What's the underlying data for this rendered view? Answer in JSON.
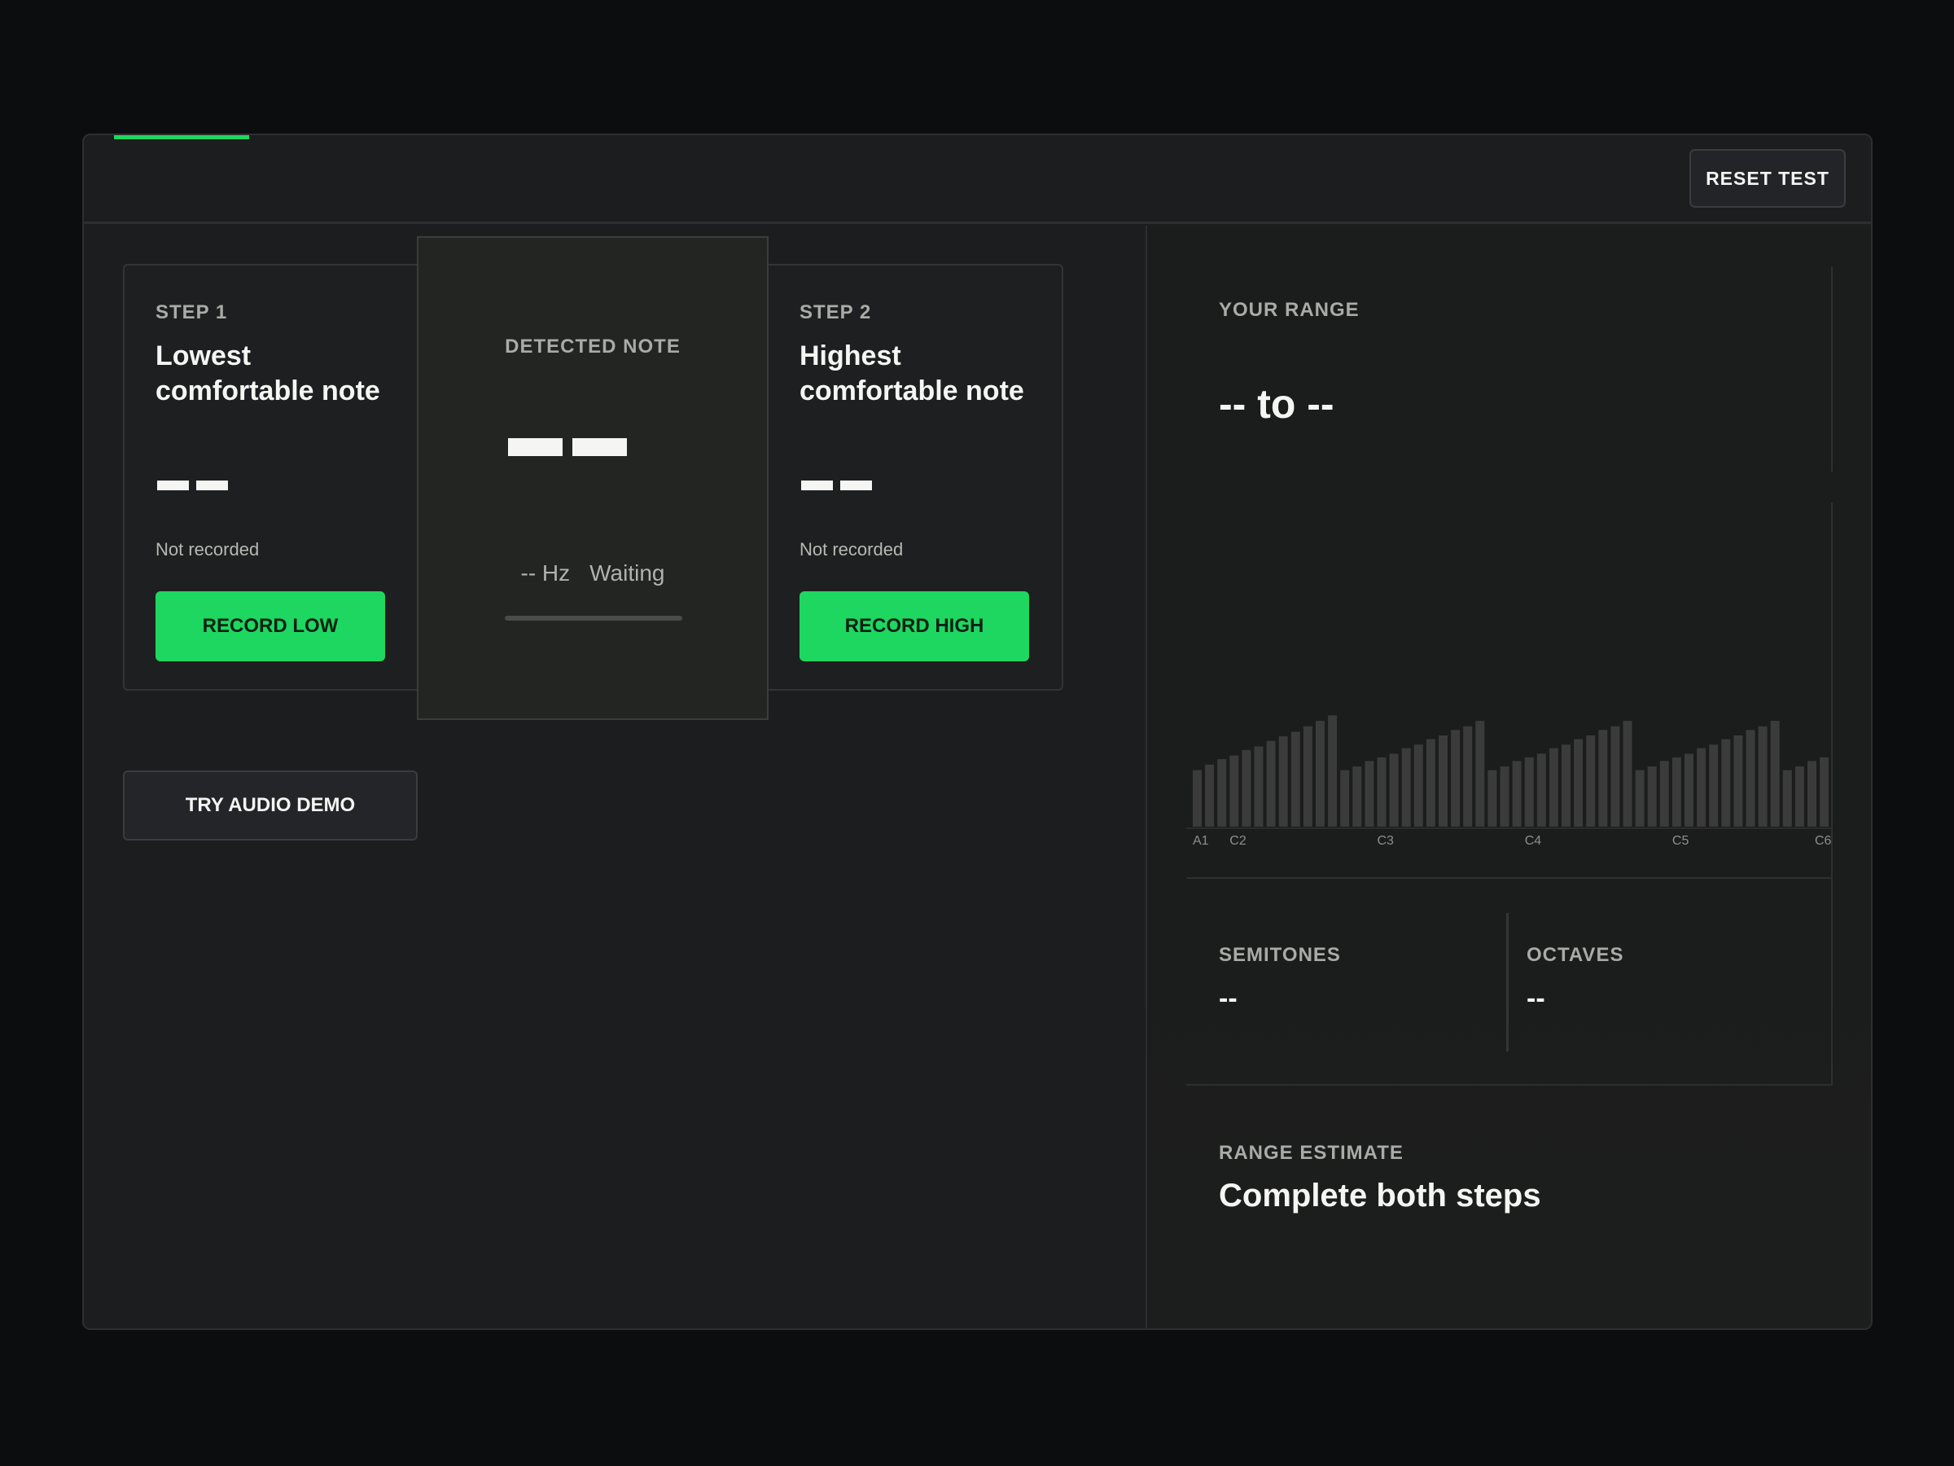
{
  "header": {
    "reset_label": "RESET TEST"
  },
  "step1": {
    "label": "STEP 1",
    "title": "Lowest comfortable note",
    "status": "Not recorded",
    "button": "RECORD LOW"
  },
  "step2": {
    "label": "STEP 2",
    "title": "Highest comfortable note",
    "status": "Not recorded",
    "button": "RECORD HIGH"
  },
  "detected": {
    "title": "DETECTED NOTE",
    "hz": "-- Hz",
    "state": "Waiting"
  },
  "demo": {
    "button": "TRY AUDIO DEMO"
  },
  "range": {
    "label": "YOUR RANGE",
    "value": "-- to --"
  },
  "keyboard": {
    "tick_labels": [
      "A1",
      "C2",
      "C3",
      "C4",
      "C5",
      "C6"
    ],
    "octave_bars": [
      [
        62,
        68,
        74,
        78,
        84,
        88,
        94,
        99,
        104,
        110,
        116,
        122
      ],
      [
        62,
        66,
        72,
        76,
        80,
        86,
        90,
        96,
        100,
        106,
        110,
        116
      ],
      [
        62,
        66,
        72,
        76,
        80,
        86,
        90,
        96,
        100,
        106,
        110,
        116
      ],
      [
        62,
        66,
        72,
        76,
        80,
        86,
        90,
        96,
        100,
        106,
        110,
        116
      ],
      [
        62,
        66,
        72,
        76
      ]
    ]
  },
  "stats": {
    "semitones_label": "SEMITONES",
    "semitones_value": "--",
    "octaves_label": "OCTAVES",
    "octaves_value": "--"
  },
  "estimate": {
    "label": "RANGE ESTIMATE",
    "value": "Complete both steps"
  },
  "colors": {
    "accent": "#1ed760",
    "bar": "#3a3b3a"
  }
}
